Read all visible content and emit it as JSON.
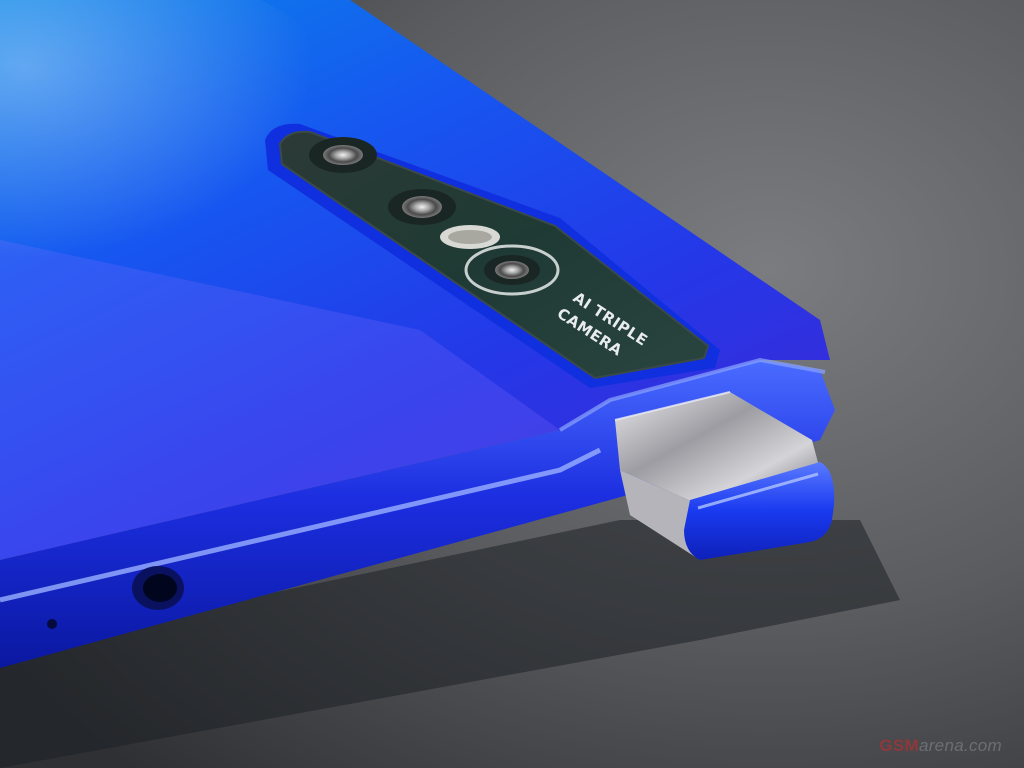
{
  "photo": {
    "subject": "smartphone-rear-popup-camera",
    "colors": {
      "body_blue": "#1a3cf0",
      "body_cyan": "#0a7be0",
      "edge_highlight": "#6a8cff",
      "camera_glass": "#1f3a34",
      "popup_silver": "#c8c8cc",
      "table_gray": "#5a5c60"
    }
  },
  "camera_module": {
    "text_line1": "AI TRIPLE",
    "text_line2": "CAMERA"
  },
  "watermark": {
    "brand": "GSM",
    "domain": "arena.com"
  }
}
